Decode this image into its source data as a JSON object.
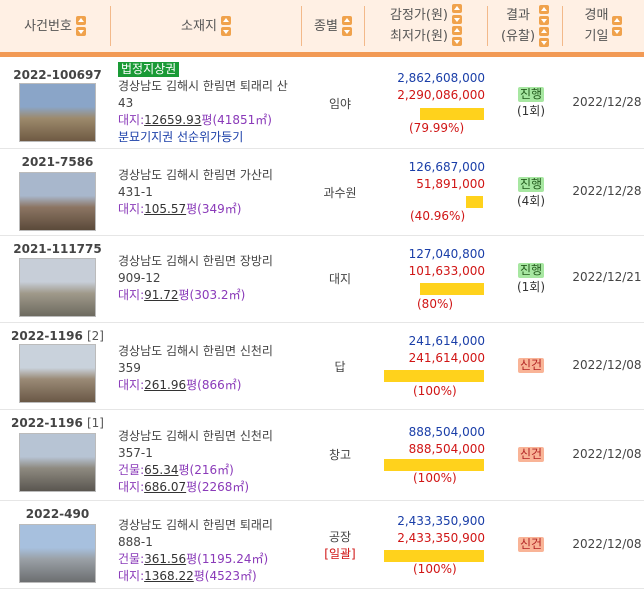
{
  "header": {
    "case_no": "사건번호",
    "location": "소재지",
    "category": "종별",
    "appraisal": "감정가(원)",
    "minimum": "최저가(원)",
    "result": "결과",
    "result_sub": "(유찰)",
    "auction": "경매",
    "auction_sub": "기일"
  },
  "rows": [
    {
      "case_no": "2022-100697",
      "case_sub": "",
      "badge": "법정지상권",
      "addr1": "경상남도 김해시 한림면 퇴래리 산",
      "addr2": "43",
      "area_lines": [
        {
          "label": "대지:",
          "pyeong": "12659.93",
          "unit": "평",
          "m2": "(41851㎡)"
        }
      ],
      "note": "분묘기지권 선순위가등기",
      "category": "임야",
      "category_note": "",
      "appraisal": "2,862,608,000",
      "minimum": "2,290,086,000",
      "ratio_text": "(79.99%)",
      "ratio_value": 79.99,
      "status": "진행",
      "status_kind": "go",
      "failed": "(1회)",
      "date": "2022/12/28"
    },
    {
      "case_no": "2021-7586",
      "case_sub": "",
      "badge": "",
      "addr1": "경상남도 김해시 한림면 가산리",
      "addr2": "431-1",
      "area_lines": [
        {
          "label": "대지:",
          "pyeong": "105.57",
          "unit": "평",
          "m2": "(349㎡)"
        }
      ],
      "note": "",
      "category": "과수원",
      "category_note": "",
      "appraisal": "126,687,000",
      "minimum": "51,891,000",
      "ratio_text": "(40.96%)",
      "ratio_value": 40.96,
      "status": "진행",
      "status_kind": "go",
      "failed": "(4회)",
      "date": "2022/12/28"
    },
    {
      "case_no": "2021-111775",
      "case_sub": "",
      "badge": "",
      "addr1": "경상남도 김해시 한림면 장방리",
      "addr2": "909-12",
      "area_lines": [
        {
          "label": "대지:",
          "pyeong": "91.72",
          "unit": "평",
          "m2": "(303.2㎡)"
        }
      ],
      "note": "",
      "category": "대지",
      "category_note": "",
      "appraisal": "127,040,800",
      "minimum": "101,633,000",
      "ratio_text": "(80%)",
      "ratio_value": 80,
      "status": "진행",
      "status_kind": "go",
      "failed": "(1회)",
      "date": "2022/12/21"
    },
    {
      "case_no": "2022-1196",
      "case_sub": "[2]",
      "badge": "",
      "addr1": "경상남도 김해시 한림면 신천리",
      "addr2": "359",
      "area_lines": [
        {
          "label": "대지:",
          "pyeong": "261.96",
          "unit": "평",
          "m2": "(866㎡)"
        }
      ],
      "note": "",
      "category": "답",
      "category_note": "",
      "appraisal": "241,614,000",
      "minimum": "241,614,000",
      "ratio_text": "(100%)",
      "ratio_value": 100,
      "status": "신건",
      "status_kind": "new",
      "failed": "",
      "date": "2022/12/08"
    },
    {
      "case_no": "2022-1196",
      "case_sub": "[1]",
      "badge": "",
      "addr1": "경상남도 김해시 한림면 신천리",
      "addr2": "357-1",
      "area_lines": [
        {
          "label": "건물:",
          "pyeong": "65.34",
          "unit": "평",
          "m2": "(216㎡)"
        },
        {
          "label": "대지:",
          "pyeong": "686.07",
          "unit": "평",
          "m2": "(2268㎡)"
        }
      ],
      "note": "",
      "category": "창고",
      "category_note": "",
      "appraisal": "888,504,000",
      "minimum": "888,504,000",
      "ratio_text": "(100%)",
      "ratio_value": 100,
      "status": "신건",
      "status_kind": "new",
      "failed": "",
      "date": "2022/12/08"
    },
    {
      "case_no": "2022-490",
      "case_sub": "",
      "badge": "",
      "addr1": "경상남도 김해시 한림면 퇴래리",
      "addr2": "888-1",
      "area_lines": [
        {
          "label": "건물:",
          "pyeong": "361.56",
          "unit": "평",
          "m2": "(1195.24㎡)"
        },
        {
          "label": "대지:",
          "pyeong": "1368.22",
          "unit": "평",
          "m2": "(4523㎡)"
        }
      ],
      "note": "",
      "category": "공장",
      "category_note": "[일괄]",
      "appraisal": "2,433,350,900",
      "minimum": "2,433,350,900",
      "ratio_text": "(100%)",
      "ratio_value": 100,
      "status": "신건",
      "status_kind": "new",
      "failed": "",
      "date": "2022/12/08"
    }
  ]
}
